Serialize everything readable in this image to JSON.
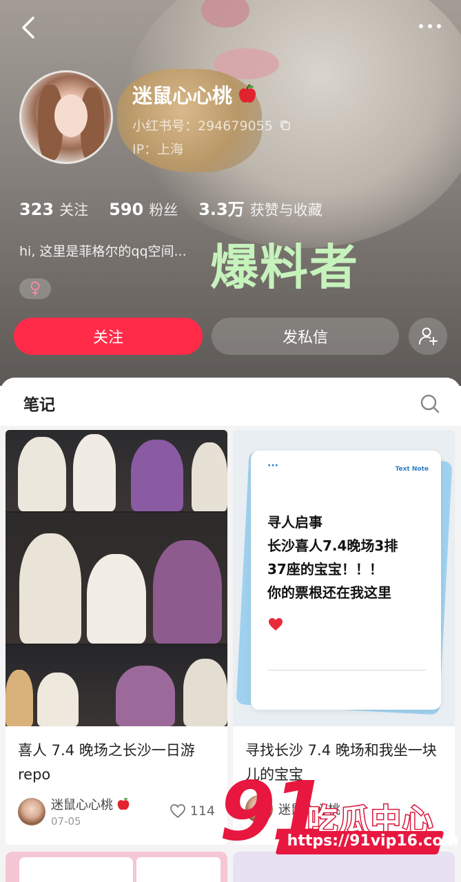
{
  "profile": {
    "username": "迷鼠心心桃",
    "uid": "小红书号：294679055",
    "ip": "IP：上海",
    "bio": "hi, 这里是菲格尔的qq空间...",
    "gender_symbol": "♀"
  },
  "stats": [
    {
      "value": "323",
      "label": "关注"
    },
    {
      "value": "590",
      "label": "粉丝"
    },
    {
      "value": "3.3万",
      "label": "获赞与收藏"
    }
  ],
  "overlay_caption": "爆料者",
  "actions": {
    "follow": "关注",
    "message": "发私信"
  },
  "tabs": {
    "notes": "笔记"
  },
  "notes": [
    {
      "title": "喜人 7.4 晚场之长沙一日游 repo",
      "author": "迷鼠心心桃",
      "date": "07-05",
      "likes": "114"
    },
    {
      "title": "寻找长沙 7.4 晚场和我坐一块儿的宝宝",
      "author": "迷鼠心心桃",
      "text_note": {
        "label": "Text Note",
        "lines": [
          "寻人启事",
          "长沙喜人7.4晚场3排",
          "37座的宝宝！！！",
          "你的票根还在我这里"
        ]
      }
    }
  ],
  "watermark": {
    "number": "91",
    "name": "吃瓜中心",
    "url": "https://91vip16.com"
  },
  "colors": {
    "accent": "#ff2b49",
    "overlay_text": "#c6f2bc",
    "watermark_red": "#e8173f"
  },
  "icons": [
    "back-icon",
    "more-icon",
    "copy-icon",
    "female-icon",
    "add-friend-icon",
    "search-icon",
    "heart-icon",
    "apple-emoji-icon"
  ]
}
